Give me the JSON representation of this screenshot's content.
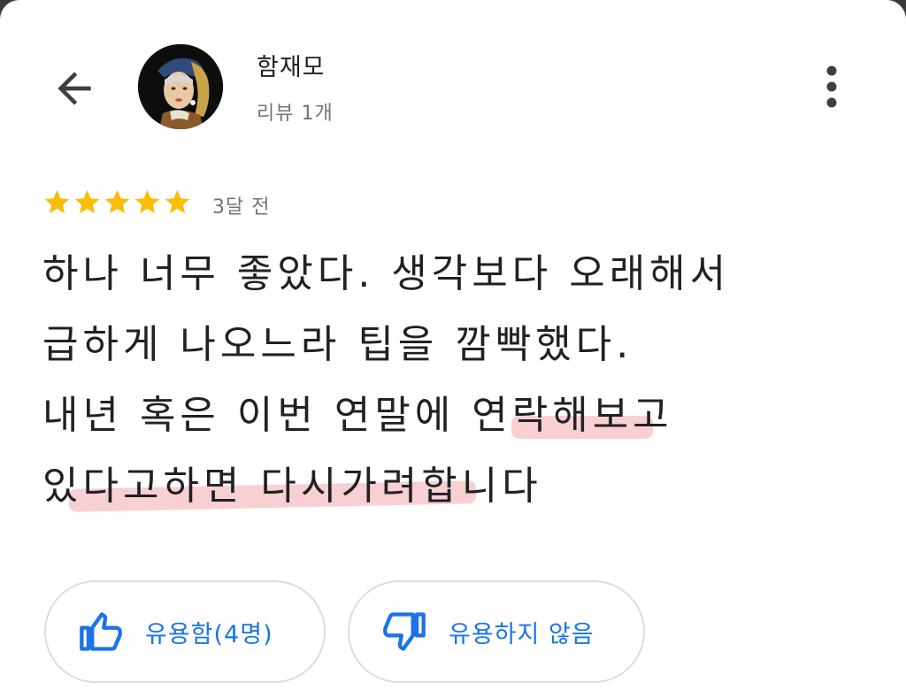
{
  "header": {
    "back_icon": "arrow-left-icon",
    "user_name": "함재모",
    "user_meta": "리뷰 1개",
    "more_icon": "more-vertical-icon"
  },
  "review": {
    "rating": 5,
    "max_rating": 5,
    "star_color": "#fbbc04",
    "time_ago": "3달 전",
    "lines": [
      "하나 너무 좋았다. 생각보다 오래해서",
      "급하게 나오느라 팁을 깜빡했다.",
      "내년 혹은 이번 연말에 연락해보고",
      "있다고하면 다시가려합니다"
    ]
  },
  "actions": {
    "helpful_label": "유용함(4명)",
    "helpful_icon": "thumbs-up-icon",
    "not_helpful_label": "유용하지 않음",
    "not_helpful_icon": "thumbs-down-icon",
    "accent_color": "#1a73e8"
  }
}
